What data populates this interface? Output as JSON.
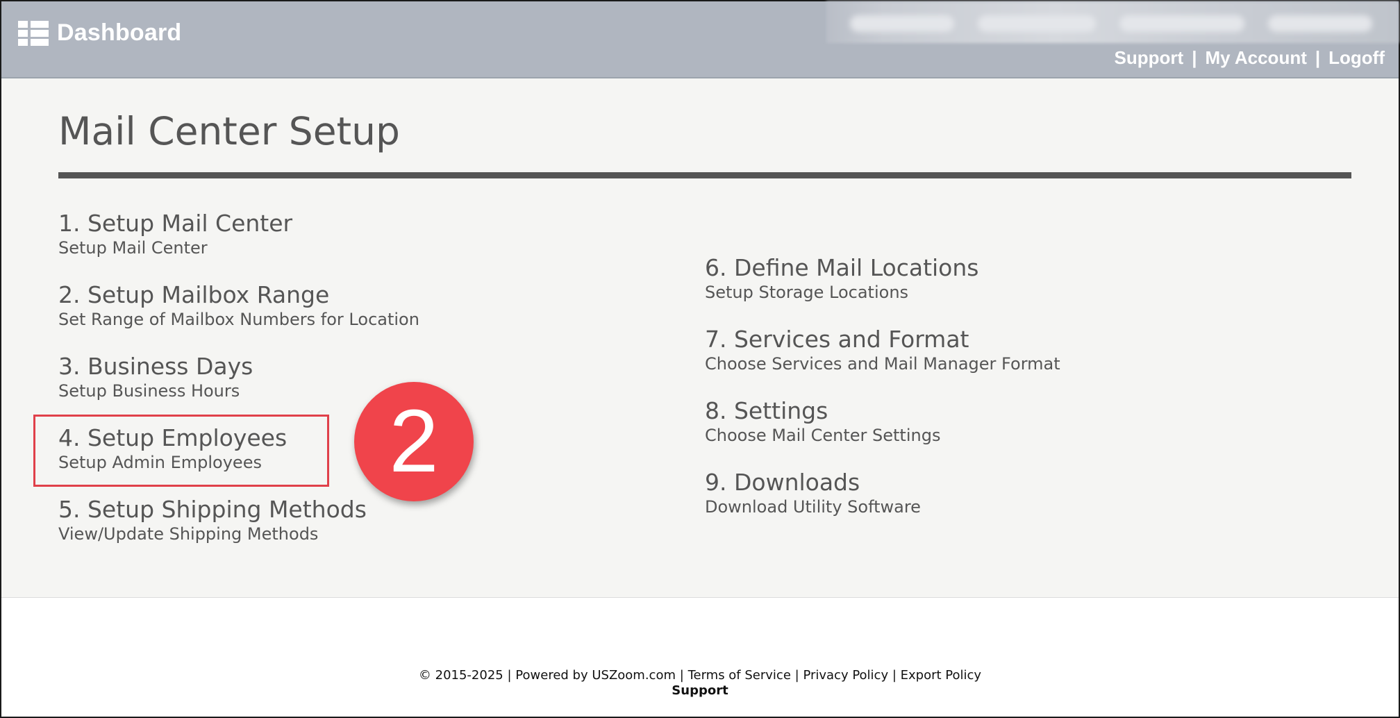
{
  "header": {
    "title": "Dashboard",
    "links": [
      "Support",
      "My Account",
      "Logoff"
    ],
    "separator": "|"
  },
  "page": {
    "title": "Mail Center Setup"
  },
  "left_items": [
    {
      "title": "1. Setup Mail Center",
      "subtitle": "Setup Mail Center"
    },
    {
      "title": "2. Setup Mailbox Range",
      "subtitle": "Set Range of Mailbox Numbers for Location"
    },
    {
      "title": "3. Business Days",
      "subtitle": "Setup Business Hours"
    },
    {
      "title": "4. Setup Employees",
      "subtitle": "Setup Admin Employees"
    },
    {
      "title": "5. Setup Shipping Methods",
      "subtitle": "View/Update Shipping Methods"
    }
  ],
  "right_items": [
    {
      "title": "6. Define Mail Locations",
      "subtitle": "Setup Storage Locations"
    },
    {
      "title": "7. Services and Format",
      "subtitle": "Choose Services and Mail Manager Format"
    },
    {
      "title": "8. Settings",
      "subtitle": "Choose Mail Center Settings"
    },
    {
      "title": "9. Downloads",
      "subtitle": "Download Utility Software"
    }
  ],
  "annotation": {
    "step_number": "2",
    "color": "#f0444b"
  },
  "footer": {
    "copyright": "© 2015-2025",
    "powered_by": "Powered by USZoom.com",
    "terms": "Terms of Service",
    "privacy": "Privacy Policy",
    "export": "Export Policy",
    "separator": "|",
    "support": "Support"
  },
  "colors": {
    "header_bg": "#b0b6c0",
    "content_bg": "#f5f5f3",
    "text": "#555555",
    "highlight_border": "#e0404a"
  }
}
